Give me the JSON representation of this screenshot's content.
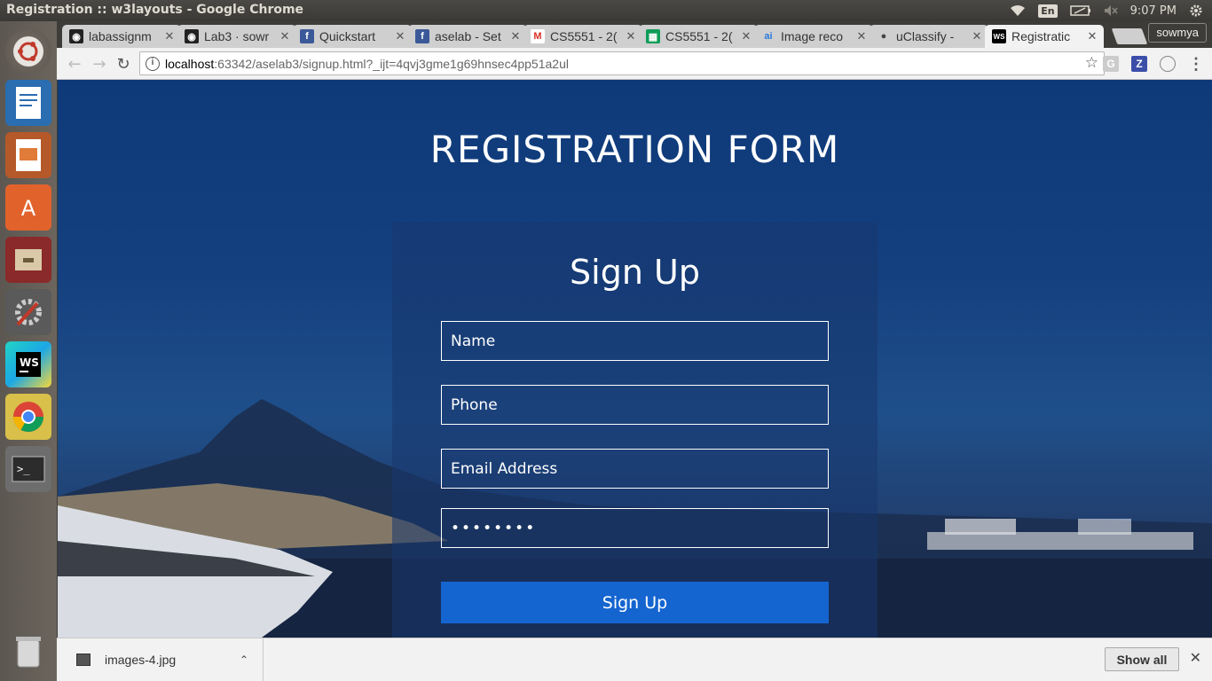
{
  "os": {
    "window_title": "Registration :: w3layouts - Google Chrome",
    "language": "En",
    "clock": "9:07 PM",
    "launcher": [
      "ubuntu-dash",
      "libreoffice-writer",
      "libreoffice-impress",
      "software-center",
      "file-manager",
      "system-settings",
      "webstorm",
      "google-chrome",
      "terminal",
      "trash"
    ]
  },
  "browser": {
    "tabs": [
      {
        "title": "labassignm",
        "icon": "github"
      },
      {
        "title": "Lab3 · sowr",
        "icon": "github"
      },
      {
        "title": "Quickstart",
        "icon": "facebook"
      },
      {
        "title": "aselab - Set",
        "icon": "facebook"
      },
      {
        "title": "CS5551 - 2(",
        "icon": "gmail"
      },
      {
        "title": "CS5551 - 2(",
        "icon": "google-sheets"
      },
      {
        "title": "Image reco",
        "icon": "ai"
      },
      {
        "title": "uClassify - ",
        "icon": "uclassify"
      },
      {
        "title": "Registratic",
        "icon": "webstorm",
        "active": true
      }
    ],
    "profile": "sowmya",
    "url": {
      "host": "localhost",
      "path": ":63342/aselab3/signup.html?_ijt=4qvj3gme1g69hnsec4pp51a2ul"
    },
    "extensions": [
      "G",
      "Z"
    ]
  },
  "page": {
    "heading": "REGISTRATION FORM",
    "form_title": "Sign Up",
    "fields": {
      "name_placeholder": "Name",
      "phone_placeholder": "Phone",
      "email_placeholder": "Email Address",
      "password_value": "••••••••"
    },
    "submit_label": "Sign Up"
  },
  "downloads": {
    "file": "images-4.jpg",
    "show_all": "Show all"
  }
}
